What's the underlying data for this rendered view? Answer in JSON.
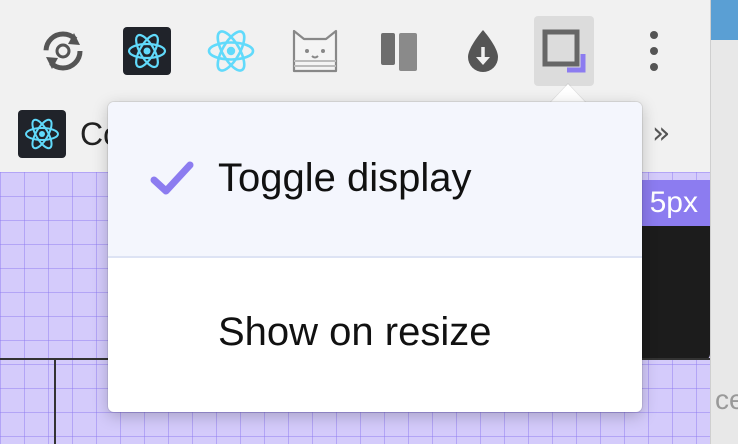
{
  "toolbar": {
    "icons": [
      "sync-icon",
      "react-devtools-dark-icon",
      "react-icon",
      "cat-icon",
      "panels-icon",
      "drop-download-icon",
      "box-resize-icon",
      "more-vert-icon"
    ]
  },
  "bookmarks": {
    "first_label": "Co",
    "overflow": "»"
  },
  "page": {
    "size_badge": "5px"
  },
  "right_strip": {
    "text": "ce"
  },
  "menu": {
    "items": [
      {
        "label": "Toggle display",
        "checked": true
      },
      {
        "label": "Show on resize",
        "checked": false
      }
    ]
  },
  "colors": {
    "accent": "#8c7cf0",
    "react_cyan": "#61dafb",
    "grid_bg": "#d4cbfb"
  }
}
